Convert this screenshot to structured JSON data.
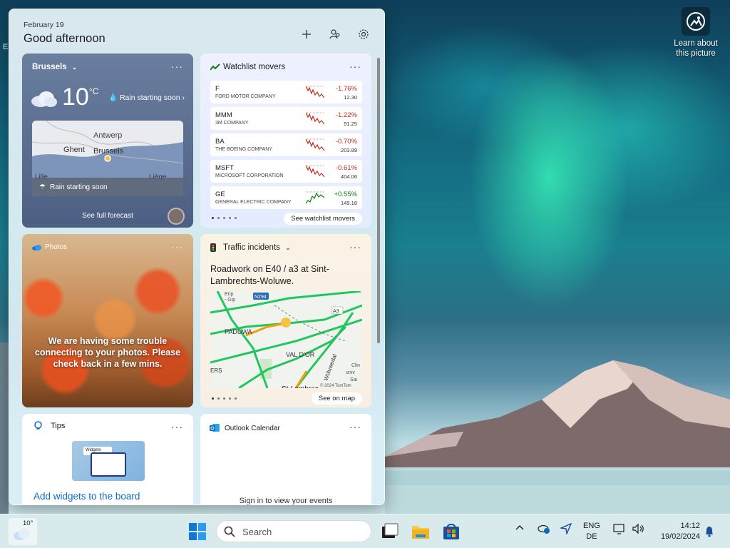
{
  "desktop": {
    "learn_label": "Learn about this picture"
  },
  "panel": {
    "date": "February 19",
    "greeting": "Good afternoon",
    "icons": [
      "add-icon",
      "people-icon",
      "gear-icon"
    ]
  },
  "weather": {
    "city": "Brussels",
    "temperature": "10",
    "unit": "°C",
    "rain_text": "Rain starting soon",
    "map_labels": [
      "Antwerp",
      "Ghent",
      "Brussels",
      "Lille",
      "Liège"
    ],
    "map_bar_text": "Rain starting soon",
    "forecast_link": "See full forecast"
  },
  "watchlist": {
    "title": "Watchlist movers",
    "stocks": [
      {
        "symbol": "F",
        "name": "FORD MOTOR COMPANY",
        "change": "-1.76%",
        "price": "12.30",
        "trend": "down"
      },
      {
        "symbol": "MMM",
        "name": "3M COMPANY",
        "change": "-1.22%",
        "price": "91.25",
        "trend": "down"
      },
      {
        "symbol": "BA",
        "name": "THE BOEING COMPANY",
        "change": "-0.70%",
        "price": "203.89",
        "trend": "down"
      },
      {
        "symbol": "MSFT",
        "name": "MICROSOFT CORPORATION",
        "change": "-0.61%",
        "price": "404.06",
        "trend": "down"
      },
      {
        "symbol": "GE",
        "name": "GENERAL ELECTRIC COMPANY",
        "change": "+0.55%",
        "price": "149.18",
        "trend": "up"
      }
    ],
    "button": "See watchlist movers"
  },
  "photos": {
    "title": "Photos",
    "message": "We are having some trouble connecting to your photos. Please check back in a few mins."
  },
  "traffic": {
    "title": "Traffic incidents",
    "headline": "Roadwork on E40 / a3 at Sint-Lambrechts-Woluwe.",
    "map_labels": [
      "Erip - Gip",
      "N294",
      "A3",
      "PADUWA",
      "VAL D'OR",
      "Woluwedal",
      "ERS",
      "Clin univ Sai Luc",
      "St-Lambrec",
      "© 2024 TomTom"
    ],
    "button": "See on map"
  },
  "tips": {
    "title": "Tips",
    "image_label": "Widgets",
    "link": "Add widgets to the board"
  },
  "calendar": {
    "title": "Outlook Calendar",
    "message": "Sign in to view your events"
  },
  "taskbar": {
    "weather_temp": "10°",
    "search_placeholder": "Search",
    "lang_line1": "ENG",
    "lang_line2": "DE",
    "time": "14:12",
    "date": "19/02/2024",
    "colors": {
      "accent": "#0f6cbd",
      "negative": "#c42b1c",
      "positive": "#107c10"
    }
  }
}
